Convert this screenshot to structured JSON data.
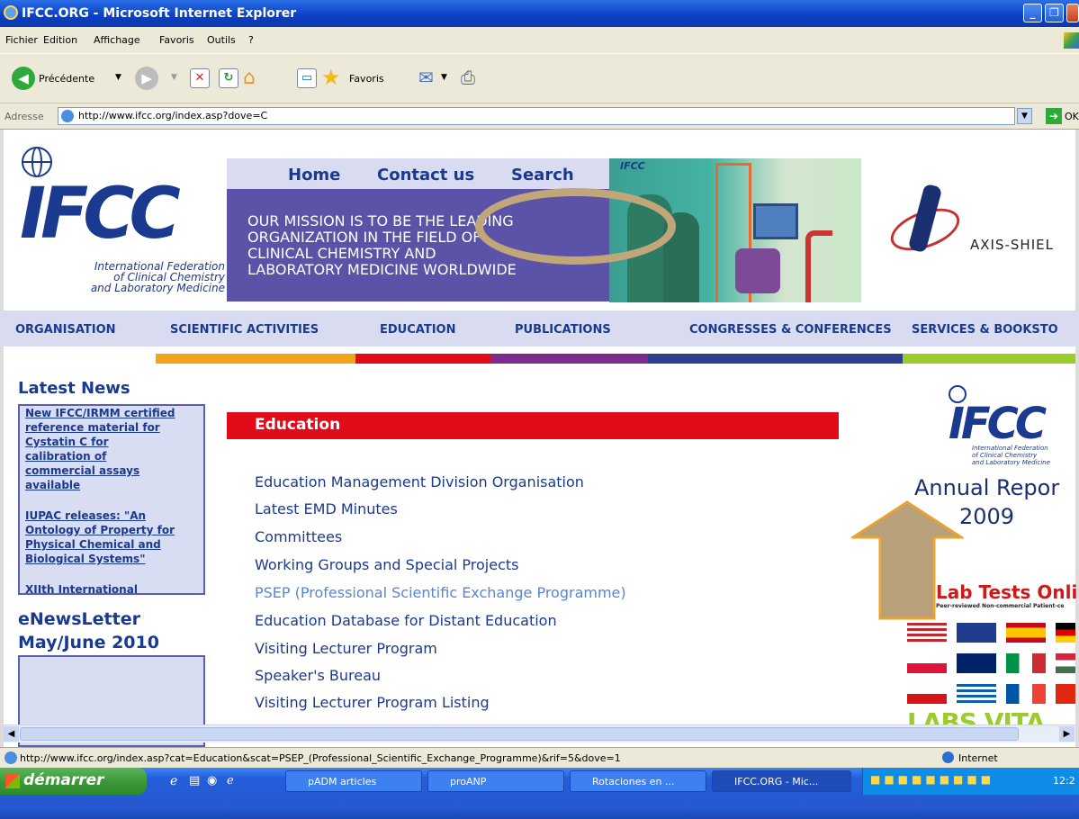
{
  "window": {
    "title": "IFCC.ORG - Microsoft Internet Explorer"
  },
  "menu": [
    "Fichier",
    "Edition",
    "Affichage",
    "Favoris",
    "Outils",
    "?"
  ],
  "toolbar": {
    "back_label": "Précédente",
    "favorites_label": "Favoris"
  },
  "address": {
    "label": "Adresse",
    "url": "http://www.ifcc.org/index.asp?dove=C",
    "go_label": "OK"
  },
  "site": {
    "logo_text": "IFCC",
    "logo_sub": "International Federation\nof Clinical Chemistry\nand Laboratory Medicine",
    "topnav": [
      "Home",
      "Contact us",
      "Search"
    ],
    "mission": "OUR MISSION IS TO BE THE LEADING\nORGANIZATION IN THE FIELD OF\nCLINICAL CHEMISTRY AND\nLABORATORY MEDICINE WORLDWIDE",
    "sponsor": "AXIS-SHIEL",
    "catnav": [
      "ORGANISATION",
      "SCIENTIFIC ACTIVITIES",
      "EDUCATION",
      "PUBLICATIONS",
      "CONGRESSES & CONFERENCES",
      "SERVICES & BOOKSTO"
    ],
    "strip_colors": [
      "#f0a51c",
      "#e10b1a",
      "#7b2c8c",
      "#2d3f8e",
      "#9ccb2e"
    ]
  },
  "sidebar": {
    "latest_title": "Latest News",
    "news": [
      "New IFCC/IRMM certified\nreference material for\nCystatin C for\ncalibration of\ncommercial assays\navailable",
      "IUPAC releases: \"An\nOntology of Property for\nPhysical Chemical and\nBiological Systems\"",
      "XIIth International\nCongress of Paediatric\nLaboratory Medicine\n(ICPLM), Berlin Germany"
    ],
    "enews": "eNewsLetter\nMay/June 2010"
  },
  "main": {
    "section_title": "Education",
    "links": [
      "Education Management Division Organisation",
      "Latest EMD Minutes",
      "Committees",
      "Working Groups and Special Projects",
      "PSEP (Professional Scientific Exchange Programme)",
      "Education Database for Distant Education",
      "Visiting Lecturer Program",
      "Speaker's Bureau",
      "Visiting Lecturer Program Listing"
    ]
  },
  "right": {
    "logo_text": "IFCC",
    "logo_sub": "International Federation\nof Clinical Chemistry\nand Laboratory Medicine",
    "annual_report": "Annual Repor",
    "year": "2009",
    "labtests": "Lab Tests Onli",
    "labtests_sub": "Peer-reviewed  Non-commercial  Patient-ce",
    "labs_vita": "LABS VITA"
  },
  "statusbar": {
    "url": "http://www.ifcc.org/index.asp?cat=Education&scat=PSEP_(Professional_Scientific_Exchange_Programme)&rif=5&dove=1",
    "zone": "Internet"
  },
  "taskbar": {
    "start": "démarrer",
    "tasks": [
      "pADM articles",
      "proANP",
      "Rotaciones en ...",
      "IFCC.ORG - Mic..."
    ],
    "clock": "12:2"
  }
}
